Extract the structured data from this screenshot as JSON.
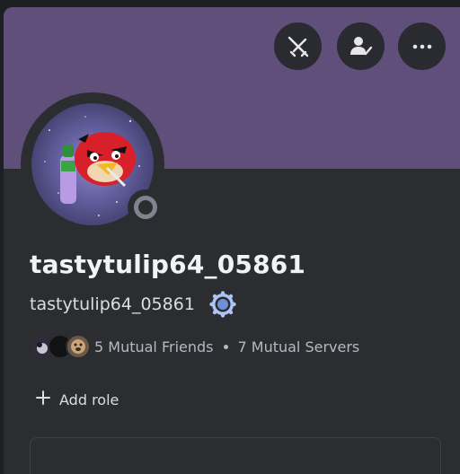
{
  "profile": {
    "display_name": "tastytulip64_05861",
    "username": "tastytulip64_05861",
    "status": "offline",
    "banner_color": "#5f4f7a"
  },
  "actions": [
    {
      "icon": "swords-slash-icon"
    },
    {
      "icon": "add-friend-icon"
    },
    {
      "icon": "more-options-icon"
    }
  ],
  "mutuals": {
    "friends_label": "5 Mutual Friends",
    "servers_label": "7 Mutual Servers"
  },
  "roles": {
    "add_role_label": "Add role"
  }
}
